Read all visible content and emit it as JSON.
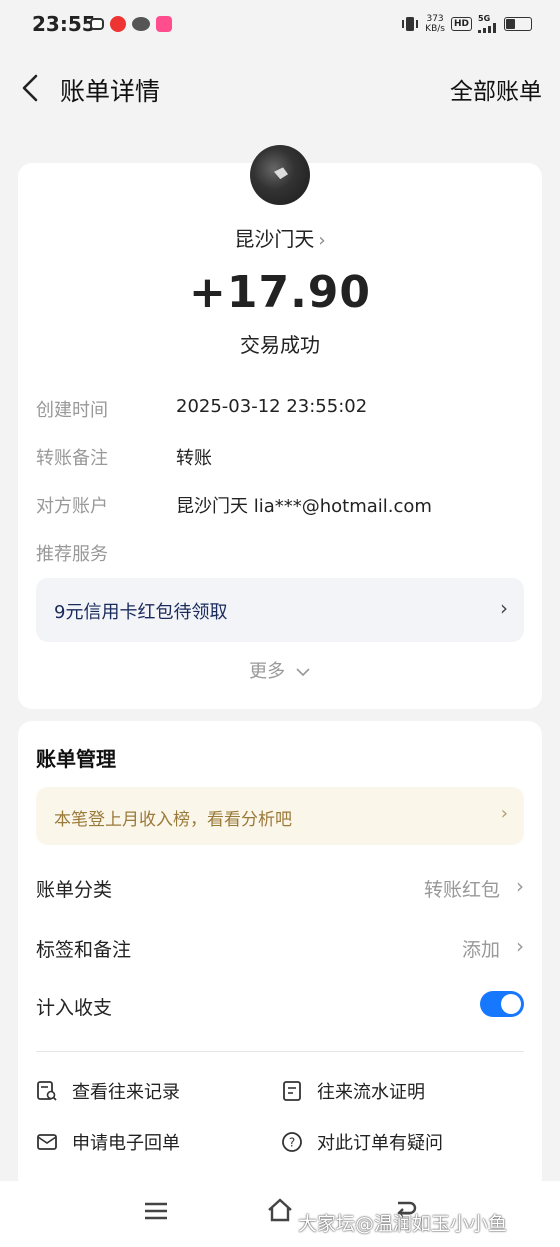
{
  "status_bar": {
    "time": "23:55",
    "net_speed_value": "373",
    "net_speed_unit": "KB/s",
    "hd_badge": "HD",
    "network": "5G",
    "battery_level": 0.35
  },
  "nav": {
    "title": "账单详情",
    "all_bills": "全部账单"
  },
  "summary": {
    "payee": "昆沙门天",
    "amount": "+17.90",
    "status": "交易成功"
  },
  "details": {
    "created_label": "创建时间",
    "created_value": "2025-03-12 23:55:02",
    "remark_label": "转账备注",
    "remark_value": "转账",
    "account_label": "对方账户",
    "account_value": "昆沙门天 lia***@hotmail.com",
    "recommend_label": "推荐服务"
  },
  "promo": {
    "text": "9元信用卡红包待领取"
  },
  "more": {
    "label": "更多"
  },
  "management": {
    "title": "账单管理",
    "insight": "本笔登上月收入榜，看看分析吧",
    "category_label": "账单分类",
    "category_value": "转账红包",
    "tags_label": "标签和备注",
    "tags_value": "添加",
    "include_label": "计入收支",
    "include_on": true
  },
  "actions": {
    "history": "查看往来记录",
    "proof": "往来流水证明",
    "receipt": "申请电子回单",
    "question": "对此订单有疑问"
  },
  "watermark": "大家坛@温润如玉小小鱼",
  "colors": {
    "accent": "#1677ff",
    "background": "#f3f3f3",
    "insight_bg": "#fbf6ea",
    "insight_text": "#9a7a3a"
  }
}
